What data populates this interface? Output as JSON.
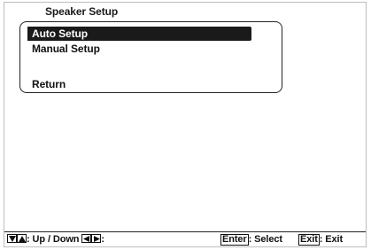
{
  "title": "Speaker Setup",
  "menu": {
    "items": [
      {
        "label": "Auto Setup",
        "selected": true
      },
      {
        "label": "Manual Setup",
        "selected": false
      },
      {
        "label": "Return",
        "selected": false
      }
    ]
  },
  "hints": {
    "updown_label": ": Up / Down",
    "leftright_label": ":",
    "enter_key": "Enter",
    "enter_label": ": Select",
    "exit_key": "Exit",
    "exit_label": ": Exit"
  },
  "icons": {
    "down": "down-arrow-icon",
    "up": "up-arrow-icon",
    "left": "left-arrow-icon",
    "right": "right-arrow-icon"
  },
  "colors": {
    "highlight": "#1a1a1a",
    "text": "#111111",
    "background": "#ffffff"
  }
}
